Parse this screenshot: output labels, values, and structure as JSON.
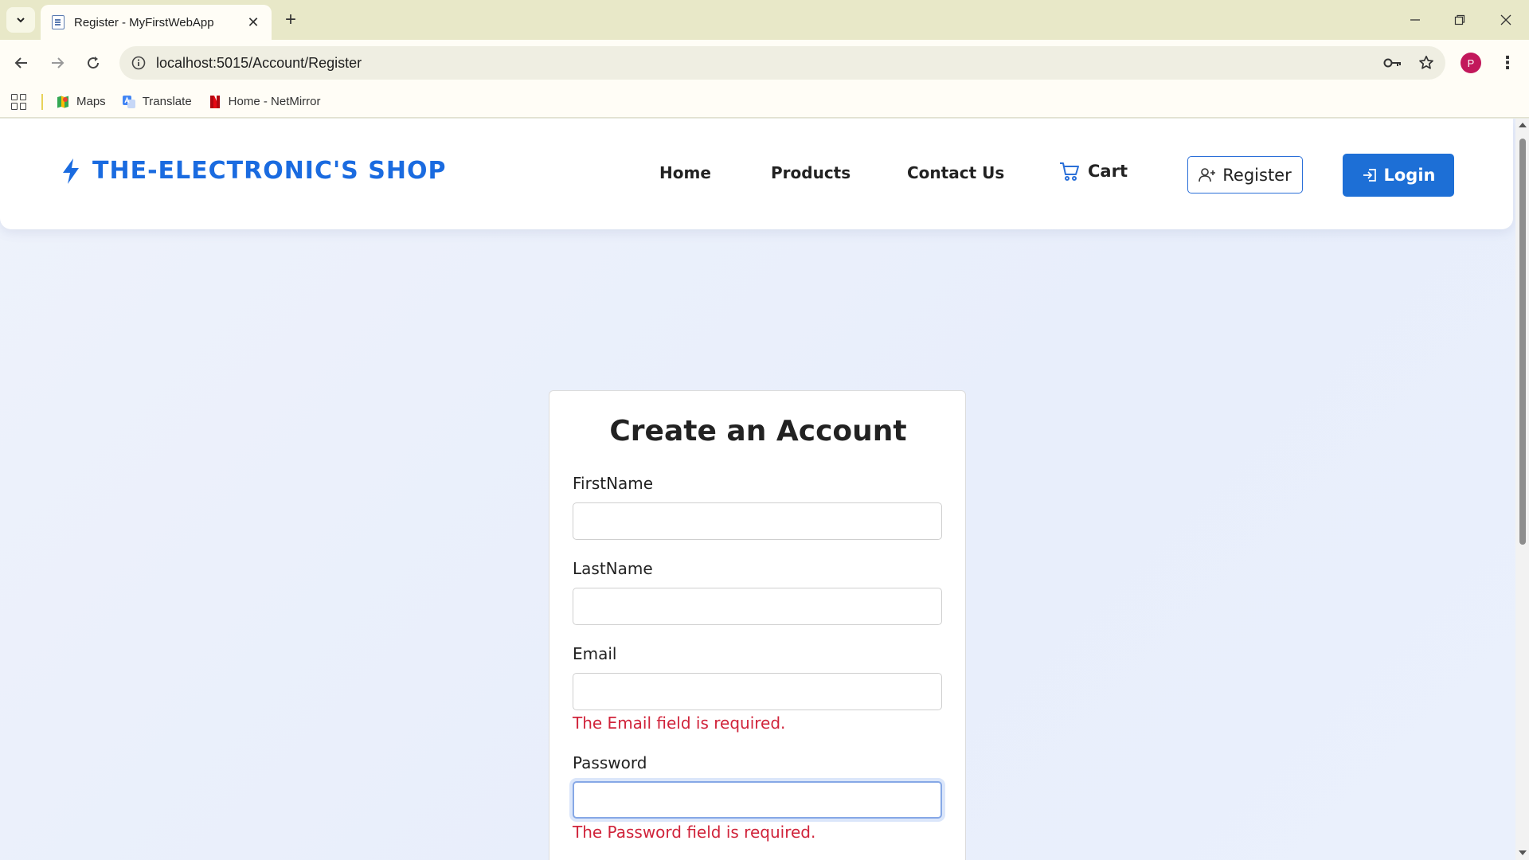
{
  "browser": {
    "tab_title": "Register - MyFirstWebApp",
    "tab_close": "✕",
    "new_tab": "+",
    "url": "localhost:5015/Account/Register",
    "profile_initial": "P",
    "menu": "⋮",
    "bookmarks": [
      {
        "label": "Maps",
        "icon": "maps-icon"
      },
      {
        "label": "Translate",
        "icon": "translate-icon"
      },
      {
        "label": "Home - NetMirror",
        "icon": "netmirror-icon"
      }
    ]
  },
  "site": {
    "brand": "THE-ELECTRONIC'S SHOP",
    "nav": [
      "Home",
      "Products",
      "Contact Us"
    ],
    "cart_label": "Cart",
    "register_label": "Register",
    "login_label": "Login"
  },
  "form": {
    "title": "Create an Account",
    "fields": [
      {
        "label": "FirstName",
        "value": "",
        "error": ""
      },
      {
        "label": "LastName",
        "value": "",
        "error": ""
      },
      {
        "label": "Email",
        "value": "",
        "error": "The Email field is required."
      },
      {
        "label": "Password",
        "value": "",
        "error": "The Password field is required."
      }
    ]
  },
  "colors": {
    "brand": "#1a6be0",
    "login_bg": "#1d6fd6",
    "error": "#d0233a",
    "page_bg": "#eaf0fc"
  }
}
